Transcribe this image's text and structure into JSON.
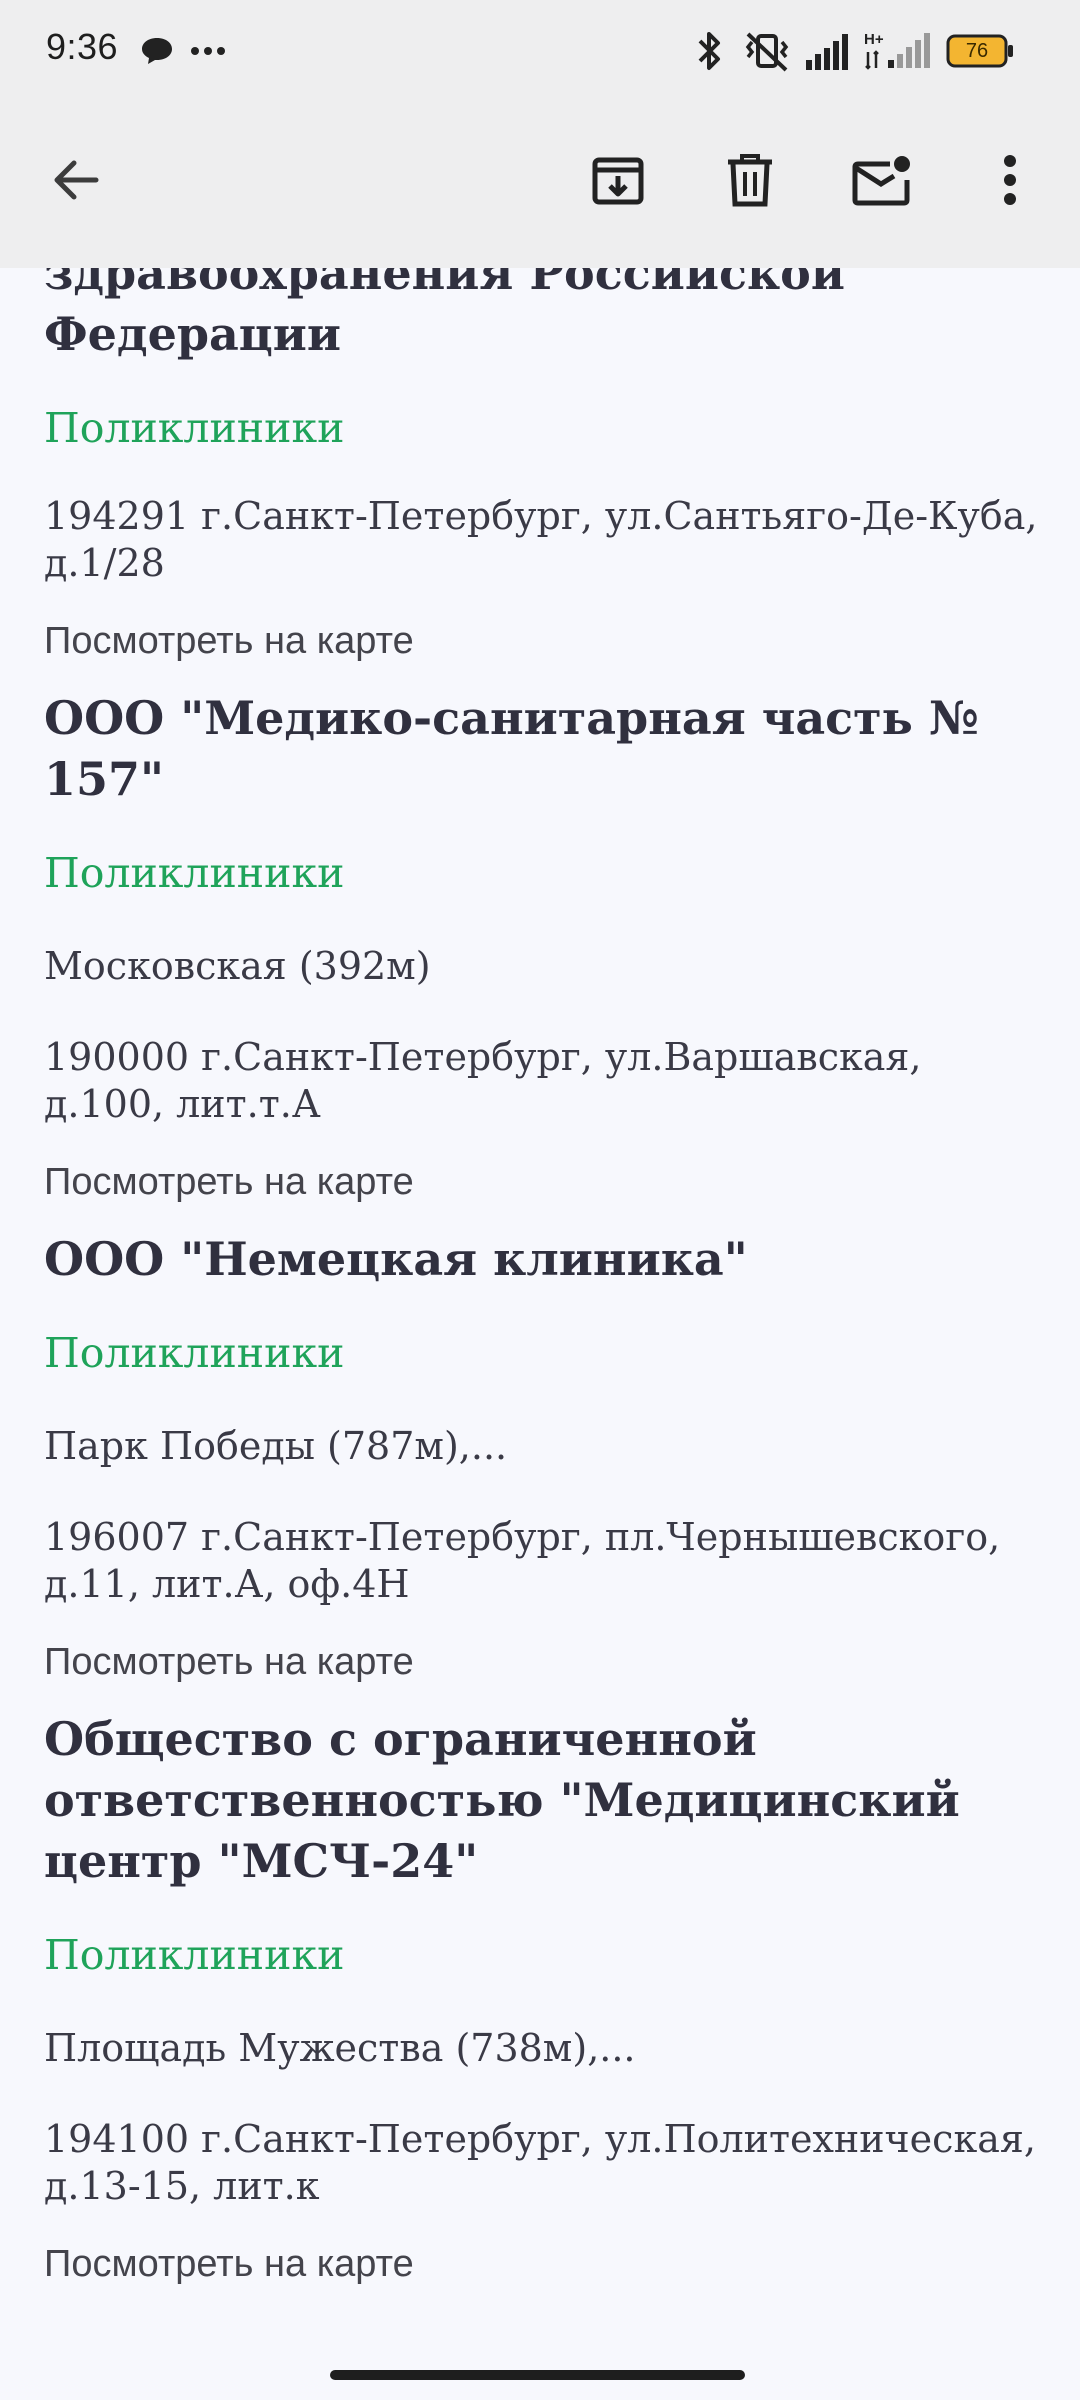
{
  "status_bar": {
    "time": "9:36",
    "battery_level": "76",
    "icons": [
      "chat-bubble-icon",
      "more-dots-icon",
      "bluetooth-icon",
      "vibrate-off-icon",
      "signal-icon",
      "hplus-signal-icon",
      "battery-icon"
    ]
  },
  "toolbar": {
    "back_icon": "arrow-left-icon",
    "archive_icon": "archive-icon",
    "delete_icon": "trash-icon",
    "unread_icon": "mail-unread-icon",
    "more_icon": "more-vert-icon"
  },
  "colors": {
    "category_green": "#1fa35a",
    "text_dark": "#30303f",
    "background": "#f7f8fd",
    "app_bar": "#eeeeef",
    "battery_fill": "#f3b531"
  },
  "entries": [
    {
      "name": "здравоохранения Российской Федерации",
      "category": "Поликлиники",
      "address": "194291 г.Санкт-Петербург, ул.Сантьяго-Де-Куба, д.1/28",
      "map_link": "Посмотреть на карте"
    },
    {
      "name": "ООО \"Медико-санитарная часть № 157\"",
      "category": "Поликлиники",
      "metro": "Московская (392м)",
      "address": "190000 г.Санкт-Петербург, ул.Варшавская, д.100, лит.т.А",
      "map_link": "Посмотреть на карте"
    },
    {
      "name": "ООО \"Немецкая клиника\"",
      "category": "Поликлиники",
      "metro": "Парк Победы (787м),...",
      "address": "196007 г.Санкт-Петербург, пл.Чернышевского, д.11, лит.А, оф.4Н",
      "map_link": "Посмотреть на карте"
    },
    {
      "name": "Общество с ограниченной ответственностью \"Медицинский центр \"МСЧ-24\"",
      "category": "Поликлиники",
      "metro": "Площадь Мужества (738м),...",
      "address": "194100 г.Санкт-Петербург, ул.Политехническая, д.13-15, лит.к",
      "map_link": "Посмотреть на карте"
    }
  ]
}
